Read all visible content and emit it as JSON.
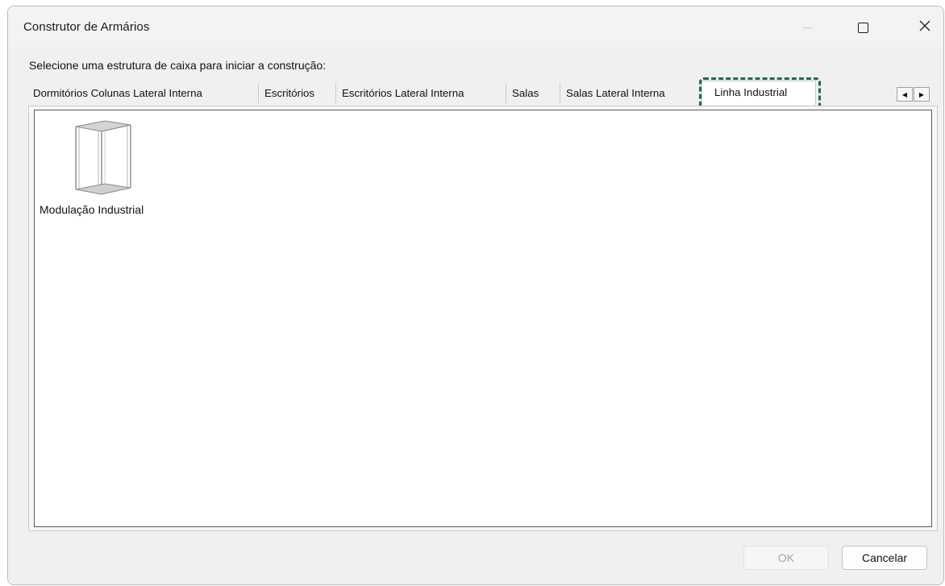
{
  "window": {
    "title": "Construtor de Armários",
    "caption_buttons": {
      "minimize_icon": "minimize-icon",
      "maximize_icon": "maximize-icon",
      "close_icon": "close-icon",
      "close_glyph": "✕"
    }
  },
  "instruction": "Selecione uma estrutura de caixa para iniciar a construção:",
  "tabs": [
    {
      "label": "Dormitórios Colunas Lateral Interna",
      "active": false
    },
    {
      "label": "Escritórios",
      "active": false
    },
    {
      "label": "Escritórios Lateral Interna",
      "active": false
    },
    {
      "label": "Salas",
      "active": false
    },
    {
      "label": "Salas Lateral Interna",
      "active": false
    },
    {
      "label": "Linha Industrial",
      "active": true
    }
  ],
  "tab_scroll": {
    "left_glyph": "◀",
    "right_glyph": "▶"
  },
  "highlight": {
    "target": "Linha Industrial",
    "color": "#1f6a4f",
    "style": "dashed"
  },
  "items": [
    {
      "label": "Modulação Industrial",
      "icon": "cabinet-icon"
    }
  ],
  "footer": {
    "ok_label": "OK",
    "ok_enabled": false,
    "cancel_label": "Cancelar"
  },
  "colors": {
    "window_bg": "#f0f0f0",
    "content_bg": "#ffffff",
    "highlight": "#1f6a4f",
    "disabled_text": "#a3a3a3"
  }
}
